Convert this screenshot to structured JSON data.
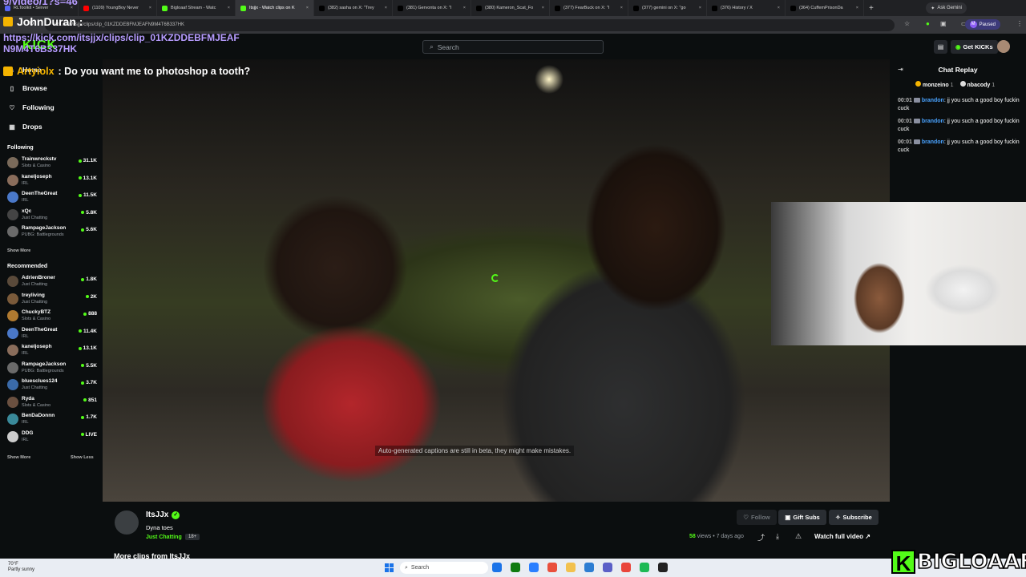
{
  "browser": {
    "tabs": [
      {
        "label": "RLToolkit • Server",
        "color": "#5865f2"
      },
      {
        "label": "(1109) YoungBoy Never",
        "color": "#ff0000"
      },
      {
        "label": "Bigloaaf Stream - Watc",
        "color": "#53fc18"
      },
      {
        "label": "Itsjjx - Watch clips on K",
        "color": "#53fc18"
      },
      {
        "label": "(382) sasha on X: \"Trey",
        "color": "#000000"
      },
      {
        "label": "(381) Gervonta on X: \"I",
        "color": "#000000"
      },
      {
        "label": "(380) Kameron_Scat_Fo",
        "color": "#000000"
      },
      {
        "label": "(377) FearBuck on X: \"I",
        "color": "#000000"
      },
      {
        "label": "(377) gemini on X: \"go",
        "color": "#000000"
      },
      {
        "label": "(376) History / X",
        "color": "#000000"
      },
      {
        "label": "(364) CuffemPrisonDa",
        "color": "#000000"
      }
    ],
    "active_tab_index": 3,
    "ask_gemini": "Ask Gemini",
    "url": "kick.com/itsjjx/clips/clip_01KZDDEBFMJEAFN9M4T6B337HK",
    "paused": "Paused",
    "profile_letter": "M"
  },
  "overlay": {
    "line1": "9/video/1?s=46",
    "line2_name": "JohnDuran :",
    "line3_url": "https://kick.com/itsjjx/clips/clip_01KZDDEBFMJEAF N9M4T6B337HK",
    "line4_name": "Artyiolx",
    "line4_msg": ": Do you want me to photoshop a tooth?"
  },
  "header": {
    "logo": "KICK",
    "search_placeholder": "Search",
    "get_kicks": "Get KICKs"
  },
  "sidebar": {
    "nav": [
      {
        "label": "Home",
        "icon": "home-icon"
      },
      {
        "label": "Browse",
        "icon": "browse-icon"
      },
      {
        "label": "Following",
        "icon": "heart-icon"
      },
      {
        "label": "Drops",
        "icon": "drops-icon"
      }
    ],
    "following_title": "Following",
    "following": [
      {
        "name": "Trainwreckstv",
        "category": "Slots & Casino",
        "viewers": "31.1K",
        "color": "#7a6a5a"
      },
      {
        "name": "kaneljoseph",
        "category": "IRL",
        "viewers": "13.1K",
        "color": "#8a6d5b"
      },
      {
        "name": "DeenTheGreat",
        "category": "IRL",
        "viewers": "11.5K",
        "color": "#4a78c8"
      },
      {
        "name": "xQc",
        "category": "Just Chatting",
        "viewers": "5.8K",
        "color": "#444444"
      },
      {
        "name": "RampageJackson",
        "category": "PUBG: Battlegrounds",
        "viewers": "5.6K",
        "color": "#6a6a6a"
      }
    ],
    "show_more_1": "Show More",
    "recommended_title": "Recommended",
    "recommended": [
      {
        "name": "AdrienBroner",
        "category": "Just Chatting",
        "viewers": "1.8K",
        "color": "#5a4a3a"
      },
      {
        "name": "treyliving",
        "category": "Just Chatting",
        "viewers": "2K",
        "color": "#7a5a3a"
      },
      {
        "name": "ChuckyBTZ",
        "category": "Slots & Casino",
        "viewers": "888",
        "color": "#b07a30"
      },
      {
        "name": "DeenTheGreat",
        "category": "IRL",
        "viewers": "11.4K",
        "color": "#4a78c8"
      },
      {
        "name": "kaneljoseph",
        "category": "IRL",
        "viewers": "13.1K",
        "color": "#8a6d5b"
      },
      {
        "name": "RampageJackson",
        "category": "PUBG: Battlegrounds",
        "viewers": "5.5K",
        "color": "#6a6a6a"
      },
      {
        "name": "bluesclues124",
        "category": "Just Chatting",
        "viewers": "3.7K",
        "color": "#3a6aa8"
      },
      {
        "name": "Ryda",
        "category": "Slots & Casino",
        "viewers": "851",
        "color": "#6a5040"
      },
      {
        "name": "BenDaDonnn",
        "category": "IRL",
        "viewers": "1.7K",
        "color": "#3a8a9a"
      },
      {
        "name": "DDG",
        "category": "IRL",
        "viewers": "LIVE",
        "color": "#cccccc"
      }
    ],
    "show_more_2": "Show More",
    "show_less": "Show Less"
  },
  "video": {
    "caption_note": "Auto-generated captions are still in beta, they might make mistakes."
  },
  "chat": {
    "title": "Chat Replay",
    "gifters": [
      {
        "name": "monzeino",
        "count": "1"
      },
      {
        "name": "nbacody",
        "count": "1"
      }
    ],
    "messages": [
      {
        "time": "00:01",
        "user": "brandon",
        "text": ": jj you such a good boy fuckin cuck"
      },
      {
        "time": "00:01",
        "user": "brandon",
        "text": ": jj you such a good boy fuckin cuck"
      },
      {
        "time": "00:01",
        "user": "brandon",
        "text": ": jj you such a good boy fuckin cuck"
      }
    ]
  },
  "clip": {
    "streamer": "ItsJJx",
    "title": "Dyna toes",
    "category": "Just Chatting",
    "age": "18+",
    "follow": "Follow",
    "gift_subs": "Gift Subs",
    "subscribe": "Subscribe",
    "views_count": "58",
    "views_suffix": "views • 7 days ago",
    "watch_full": "Watch full video",
    "more_clips": "More clips from ItsJJx"
  },
  "taskbar": {
    "temp": "70°F",
    "weather": "Partly sunny",
    "search": "Search",
    "apps": [
      "#1a73e8",
      "#0f7b0f",
      "#2a7fff",
      "#e94f3c",
      "#f2c14e",
      "#2d7dd2",
      "#5b5fc7",
      "#e9453b",
      "#1db954",
      "#222222"
    ]
  },
  "watermark": {
    "k": "K",
    "text": "BIGLOAAF"
  }
}
